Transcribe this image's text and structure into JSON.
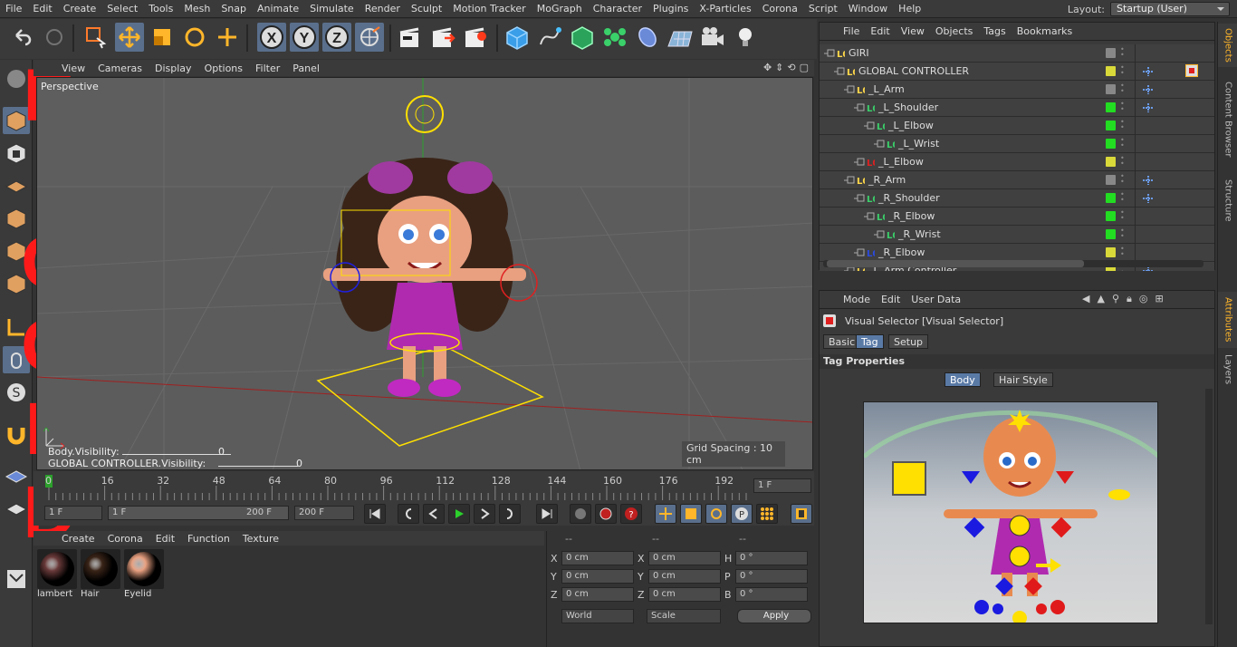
{
  "menubar": {
    "items": [
      "File",
      "Edit",
      "Create",
      "Select",
      "Tools",
      "Mesh",
      "Snap",
      "Animate",
      "Simulate",
      "Render",
      "Sculpt",
      "Motion Tracker",
      "MoGraph",
      "Character",
      "Plugins",
      "X-Particles",
      "Corona",
      "Script",
      "Window",
      "Help"
    ],
    "layout_label": "Layout:",
    "layout_value": "Startup (User)"
  },
  "toolbar": {
    "icons": [
      "undo-icon",
      "redo-icon",
      "live-selection-icon",
      "move-icon",
      "scale-icon",
      "rotate-icon",
      "add-icon",
      "x-axis-icon",
      "y-axis-icon",
      "z-axis-icon",
      "world-coord-icon",
      "render-view-icon",
      "render-picture-icon",
      "render-settings-icon",
      "cube-icon",
      "spline-pen-icon",
      "subdivision-icon",
      "cloner-icon",
      "deformer-icon",
      "floor-icon",
      "camera-icon",
      "light-icon"
    ],
    "axis_x": "X",
    "axis_y": "Y",
    "axis_z": "Z"
  },
  "viewport": {
    "menu": [
      "View",
      "Cameras",
      "Display",
      "Options",
      "Filter",
      "Panel"
    ],
    "label": "Perspective",
    "grid_spacing": "Grid Spacing : 10 cm",
    "sliders": [
      {
        "label": "Body.Visibility:",
        "value": "0"
      },
      {
        "label": "GLOBAL CONTROLLER.Visibility:",
        "value": "0"
      }
    ]
  },
  "overlay_text": [
    "R",
    "I",
    "G",
    "G",
    "E",
    "D"
  ],
  "timeline": {
    "ticks": [
      "0",
      "16",
      "32",
      "48",
      "64",
      "80",
      "96",
      "112",
      "128",
      "144",
      "160",
      "176",
      "192"
    ],
    "current_frame": "1 F",
    "start_frame": "1 F",
    "range_start": "1 F",
    "range_end": "200 F",
    "end_frame": "200 F"
  },
  "materials": {
    "menu": [
      "Create",
      "Corona",
      "Edit",
      "Function",
      "Texture"
    ],
    "items": [
      {
        "name": "lambert",
        "color": "#6a3a3a"
      },
      {
        "name": "Hair",
        "color": "#3a2418"
      },
      {
        "name": "Eyelid",
        "color": "#e8a080"
      }
    ]
  },
  "coords": {
    "headers": [
      "--",
      "--",
      "--"
    ],
    "rows": [
      {
        "a": "X",
        "av": "0 cm",
        "b": "X",
        "bv": "0 cm",
        "c": "H",
        "cv": "0 °"
      },
      {
        "a": "Y",
        "av": "0 cm",
        "b": "Y",
        "bv": "0 cm",
        "c": "P",
        "cv": "0 °"
      },
      {
        "a": "Z",
        "av": "0 cm",
        "b": "Z",
        "bv": "0 cm",
        "c": "B",
        "cv": "0 °"
      }
    ],
    "mode1": "World",
    "mode2": "Scale",
    "apply": "Apply"
  },
  "objects": {
    "menu": [
      "File",
      "Edit",
      "View",
      "Objects",
      "Tags",
      "Bookmarks"
    ],
    "tree": [
      {
        "name": "GIRI",
        "indent": 0,
        "dot": "#888"
      },
      {
        "name": "GLOBAL CONTROLLER",
        "indent": 1,
        "dot": "#d9d93a"
      },
      {
        "name": "_L_Arm",
        "indent": 2,
        "dot": "#888"
      },
      {
        "name": "_L_Shoulder",
        "indent": 3,
        "dot": "#22dd22"
      },
      {
        "name": "_L_Elbow",
        "indent": 4,
        "dot": "#22dd22"
      },
      {
        "name": "_L_Wrist",
        "indent": 5,
        "dot": "#22dd22"
      },
      {
        "name": "_L_Elbow",
        "indent": 3,
        "dot": "#d9d93a"
      },
      {
        "name": "_R_Arm",
        "indent": 2,
        "dot": "#888"
      },
      {
        "name": "_R_Shoulder",
        "indent": 3,
        "dot": "#22dd22"
      },
      {
        "name": "_R_Elbow",
        "indent": 4,
        "dot": "#22dd22"
      },
      {
        "name": "_R_Wrist",
        "indent": 5,
        "dot": "#22dd22"
      },
      {
        "name": "_R_Elbow",
        "indent": 3,
        "dot": "#d9d93a"
      },
      {
        "name": "_L_Arm Controller",
        "indent": 2,
        "dot": "#d9d93a"
      }
    ]
  },
  "right_tabs": [
    "Objects",
    "Content Browser",
    "Structure",
    "Attributes",
    "Layers"
  ],
  "attributes": {
    "menu": [
      "Mode",
      "Edit",
      "User Data"
    ],
    "title": "Visual Selector [Visual Selector]",
    "tabs": [
      "Basic",
      "Tag",
      "Setup"
    ],
    "active_tab": "Tag",
    "section": "Tag Properties",
    "subtabs": [
      "Body",
      "Hair Style"
    ],
    "active_subtab": "Body"
  },
  "colors": {
    "accent": "#5a7aa6",
    "overlay": "#ff1a1a",
    "selected_tool": "#5a6f8c"
  }
}
